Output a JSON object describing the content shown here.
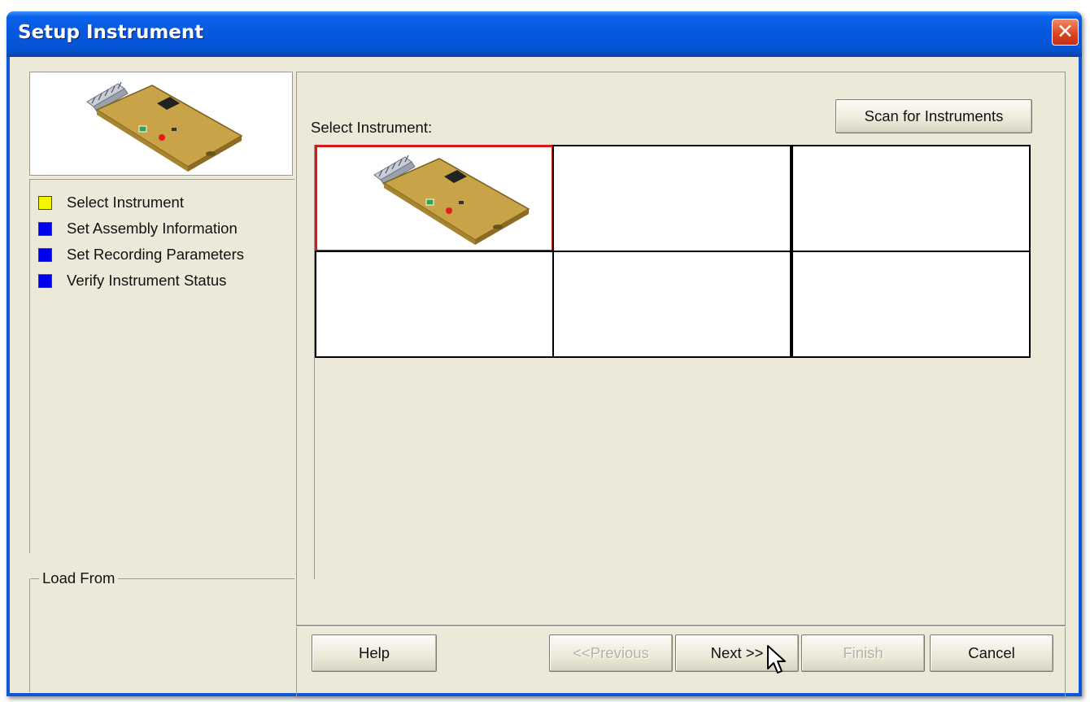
{
  "window": {
    "title": "Setup Instrument",
    "close_label": "✕"
  },
  "steps": [
    {
      "label": "Select Instrument",
      "color": "#f5f500",
      "state": "current"
    },
    {
      "label": "Set Assembly Information",
      "color": "#0000ee",
      "state": "pending"
    },
    {
      "label": "Set Recording Parameters",
      "color": "#0000ee",
      "state": "pending"
    },
    {
      "label": "Verify Instrument Status",
      "color": "#0000ee",
      "state": "pending"
    }
  ],
  "load_from": {
    "label": "Load From"
  },
  "main": {
    "select_label": "Select Instrument:",
    "scan_button": "Scan for Instruments",
    "instrument_slots": [
      {
        "occupied": true,
        "selected": true
      },
      {
        "occupied": false,
        "selected": false
      },
      {
        "occupied": false,
        "selected": false
      },
      {
        "occupied": false,
        "selected": false
      },
      {
        "occupied": false,
        "selected": false
      },
      {
        "occupied": false,
        "selected": false
      }
    ]
  },
  "buttons": {
    "help": "Help",
    "previous": "<<Previous",
    "next": "Next >>",
    "finish": "Finish",
    "cancel": "Cancel"
  },
  "colors": {
    "selection_border": "#d81a1a",
    "titlebar": "#0558de",
    "dialog_bg": "#ece9d8"
  }
}
